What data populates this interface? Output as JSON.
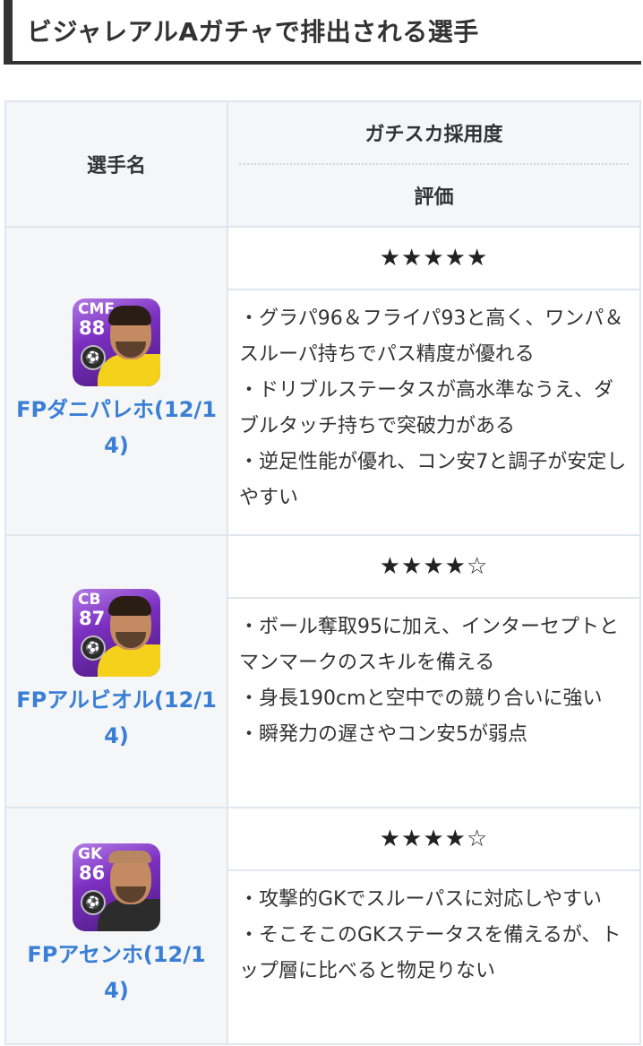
{
  "heading": "ビジャレアルAガチャで排出される選手",
  "table": {
    "header_player": "選手名",
    "header_usage": "ガチスカ採用度",
    "header_eval": "評価"
  },
  "players": [
    {
      "name": "FPダニパレホ(12/14)",
      "position": "CMF",
      "rating": "88",
      "stars": "★★★★★",
      "points": [
        "・グラパ96＆フライパ93と高く、ワンパ＆スルーパ持ちでパス精度が優れる",
        "・ドリブルステータスが高水準なうえ、ダブルタッチ持ちで突破力がある",
        "・逆足性能が優れ、コン安7と調子が安定しやすい"
      ]
    },
    {
      "name": "FPアルビオル(12/14)",
      "position": "CB",
      "rating": "87",
      "stars": "★★★★☆",
      "points": [
        "・ボール奪取95に加え、インターセプトとマンマークのスキルを備える",
        "・身長190cmと空中での競り合いに強い",
        "・瞬発力の遅さやコン安5が弱点"
      ]
    },
    {
      "name": "FPアセンホ(12/14)",
      "position": "GK",
      "rating": "86",
      "stars": "★★★★☆",
      "points": [
        "・攻撃的GKでスルーパスに対応しやすい",
        "・そこそこのGKステータスを備えるが、トップ層に比べると物足りない"
      ]
    }
  ],
  "colors": {
    "link": "#3a7fd5",
    "header_bg": "#f4f6f8",
    "border": "#dfe6ec",
    "card_purple": "#7b2fc0"
  }
}
